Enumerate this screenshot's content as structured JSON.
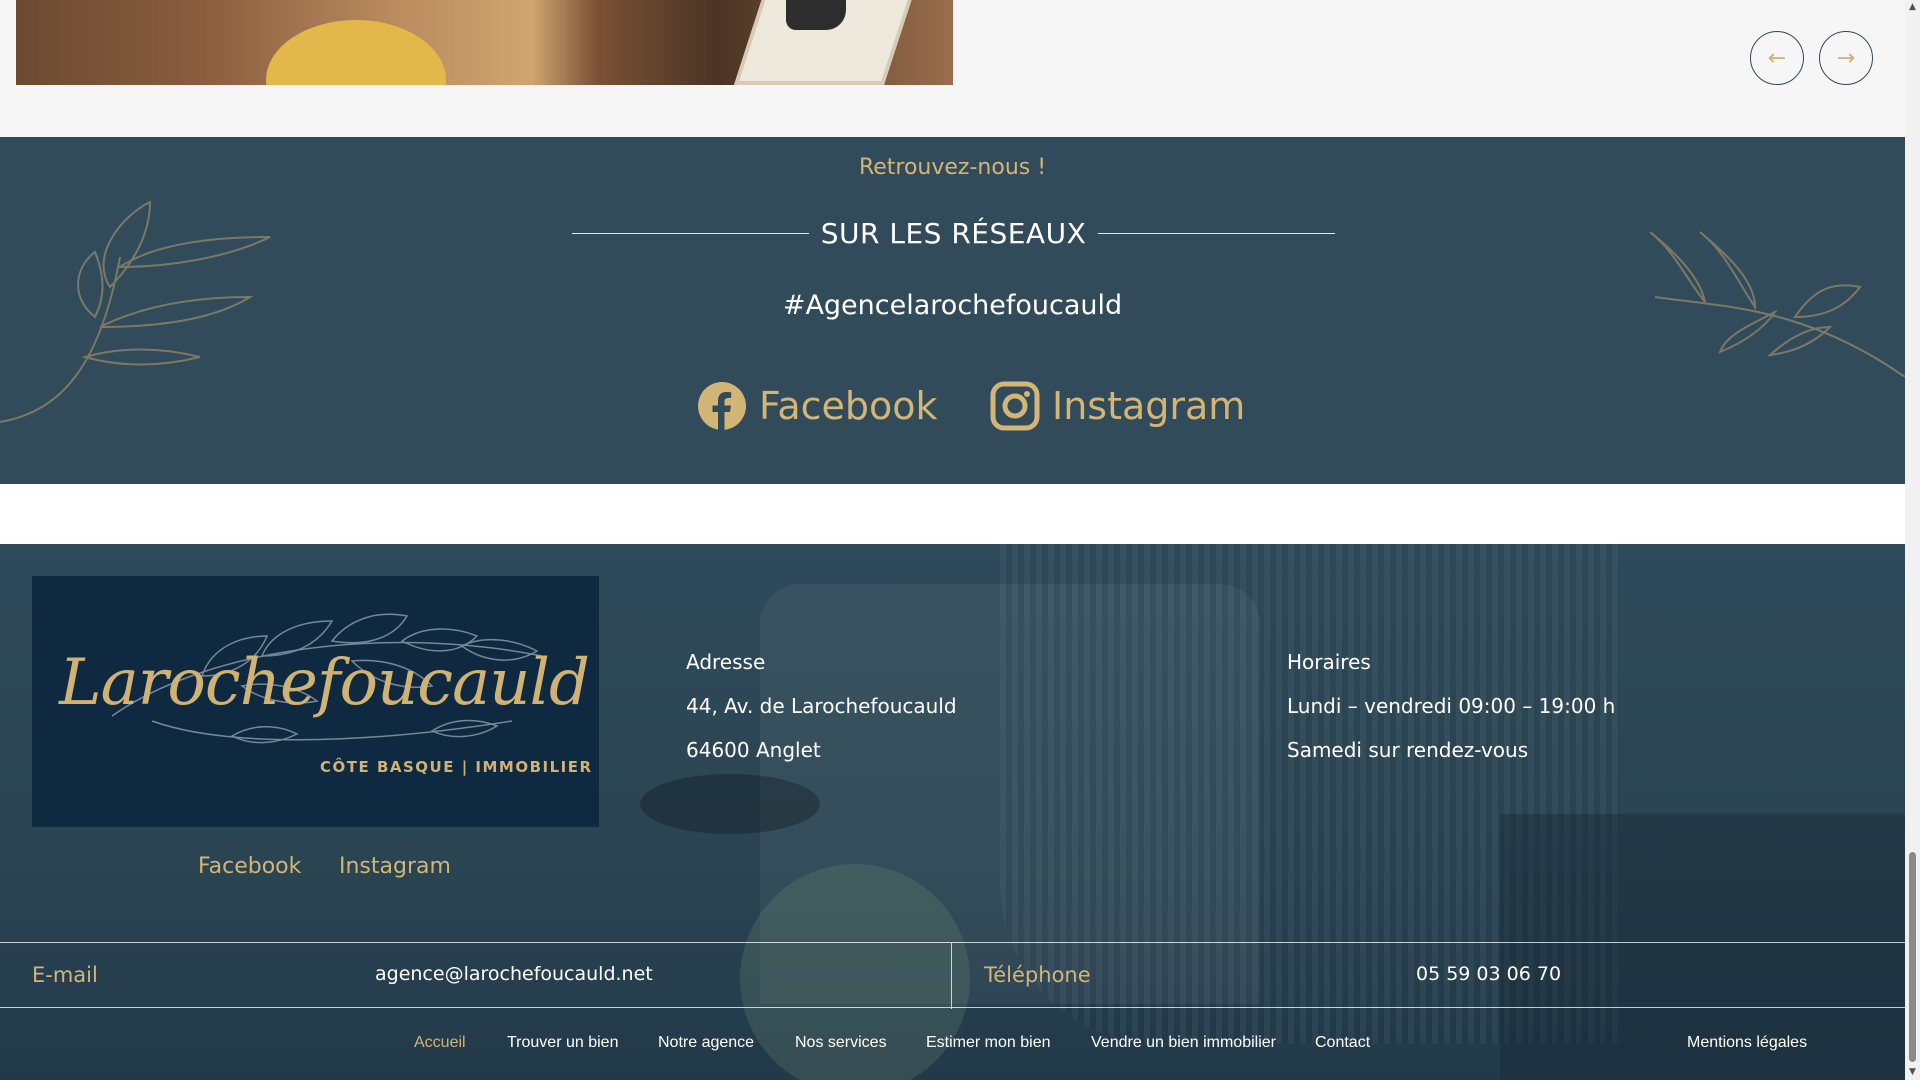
{
  "carousel": {
    "prev_label": "←",
    "next_label": "→"
  },
  "social_section": {
    "kicker": "Retrouvez-nous !",
    "heading": "SUR LES RÉSEAUX",
    "hashtag": "#Agencelarochefoucauld",
    "links": [
      {
        "label": "Facebook",
        "icon": "facebook-icon"
      },
      {
        "label": "Instagram",
        "icon": "instagram-icon"
      }
    ],
    "accent_color": "#d2b577",
    "background_color": "#324b5a"
  },
  "footer": {
    "logo": {
      "script": "Larochefoucauld",
      "tagline": "CÔTE BASQUE | IMMOBILIER"
    },
    "social_links": [
      "Facebook",
      "Instagram"
    ],
    "address": {
      "title": "Adresse",
      "line1": "44, Av. de Larochefoucauld",
      "line2": "64600 Anglet"
    },
    "hours": {
      "title": "Horaires",
      "line1": "Lundi – vendredi 09:00 – 19:00 h",
      "line2": "Samedi sur rendez-vous"
    },
    "contact": {
      "email_label": "E-mail",
      "email_value": "agence@larochefoucauld.net",
      "phone_label": "Téléphone",
      "phone_value": "05 59 03 06 70"
    },
    "nav": [
      {
        "label": "Accueil",
        "active": true
      },
      {
        "label": "Trouver un bien"
      },
      {
        "label": "Notre agence"
      },
      {
        "label": "Nos services"
      },
      {
        "label": "Estimer mon bien"
      },
      {
        "label": "Vendre un bien immobilier"
      },
      {
        "label": "Contact"
      },
      {
        "label": "Mentions légales"
      }
    ]
  }
}
